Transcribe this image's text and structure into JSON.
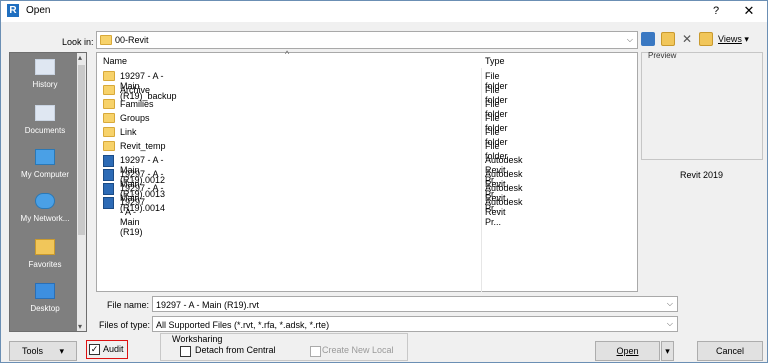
{
  "window": {
    "title": "Open",
    "help": "?",
    "close": "✕"
  },
  "lookin": {
    "label": "Look in:",
    "value": "00-Revit"
  },
  "toolbar": {
    "views": "Views"
  },
  "places": [
    {
      "label": "History"
    },
    {
      "label": "Documents"
    },
    {
      "label": "My Computer"
    },
    {
      "label": "My Network..."
    },
    {
      "label": "Favorites"
    },
    {
      "label": "Desktop"
    }
  ],
  "list": {
    "headers": {
      "name": "Name",
      "type": "Type"
    },
    "rows": [
      {
        "name": "19297 - A - Main (R19)_backup",
        "type": "File folder",
        "kind": "folder"
      },
      {
        "name": "Archive",
        "type": "File folder",
        "kind": "folder"
      },
      {
        "name": "Families",
        "type": "File folder",
        "kind": "folder"
      },
      {
        "name": "Groups",
        "type": "File folder",
        "kind": "folder"
      },
      {
        "name": "Link",
        "type": "File folder",
        "kind": "folder"
      },
      {
        "name": "Revit_temp",
        "type": "File folder",
        "kind": "folder"
      },
      {
        "name": "19297 - A - Main (R19).0012",
        "type": "Autodesk Revit Pr...",
        "kind": "rvt"
      },
      {
        "name": "19297 - A - Main (R19).0013",
        "type": "Autodesk Revit Pr...",
        "kind": "rvt"
      },
      {
        "name": "19297 - A - Main (R19).0014",
        "type": "Autodesk Revit Pr...",
        "kind": "rvt"
      },
      {
        "name": "19297 - A - Main (R19)",
        "type": "Autodesk Revit Pr...",
        "kind": "rvt"
      }
    ]
  },
  "preview": {
    "label": "Preview",
    "version": "Revit 2019"
  },
  "filename": {
    "label": "File name:",
    "value": "19297 - A - Main (R19).rvt"
  },
  "filetype": {
    "label": "Files of type:",
    "value": "All Supported Files  (*.rvt, *.rfa, *.adsk, *.rte)"
  },
  "bottom": {
    "tools": "Tools",
    "audit": "Audit",
    "audit_checked": true,
    "worksharing": "Worksharing",
    "detach": "Detach from Central",
    "create_new_local": "Create New Local",
    "open": "Open",
    "cancel": "Cancel"
  },
  "colors": {
    "accent": "#1f6fc0",
    "audit_highlight": "#dd1111",
    "places_bg": "#7f7f7f"
  }
}
